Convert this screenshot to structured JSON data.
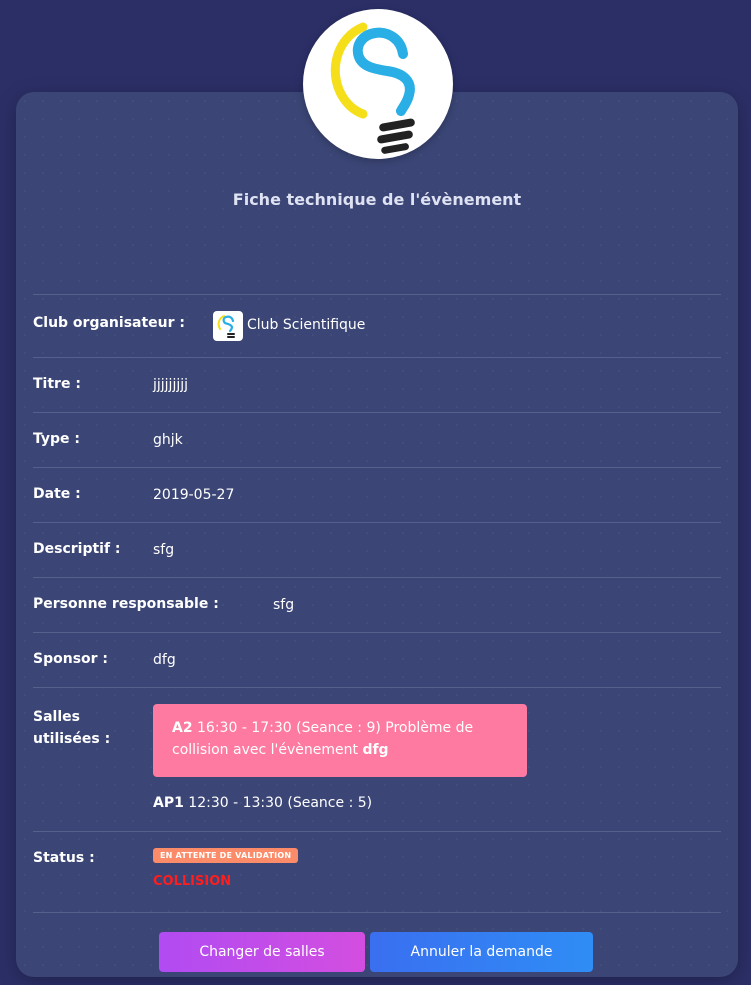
{
  "header": {
    "title": "Fiche technique de l'évènement"
  },
  "fields": {
    "club": {
      "label": "Club organisateur :",
      "value": "Club Scientifique"
    },
    "titre": {
      "label": "Titre :",
      "value": "jjjjjjjjj"
    },
    "type": {
      "label": "Type :",
      "value": "ghjk"
    },
    "date": {
      "label": "Date :",
      "value": "2019-05-27"
    },
    "descriptif": {
      "label": "Descriptif :",
      "value": "sfg"
    },
    "responsable": {
      "label": "Personne responsable :",
      "value": "sfg"
    },
    "sponsor": {
      "label": "Sponsor :",
      "value": "dfg"
    },
    "salles": {
      "label_line1": "Salles",
      "label_line2": "utilisées :",
      "conflict": {
        "room": "A2",
        "text": " 16:30 - 17:30 (Seance : 9) Problème de collision avec l'évènement ",
        "event": "dfg"
      },
      "other": {
        "room": "AP1",
        "text": " 12:30 - 13:30 (Seance : 5)"
      }
    },
    "status": {
      "label": "Status :",
      "badge": "EN ATTENTE DE VALIDATION",
      "collision": "COLLISION"
    }
  },
  "actions": {
    "change_rooms": "Changer de salles",
    "cancel_request": "Annuler la demande"
  },
  "colors": {
    "background": "#2b2f66",
    "card": "#3b4676",
    "alert": "#fe7aa0",
    "badge": "#fb8b69",
    "collision": "#ff1d1d",
    "logo_blue": "#29aee6",
    "logo_yellow": "#f4df1a"
  }
}
